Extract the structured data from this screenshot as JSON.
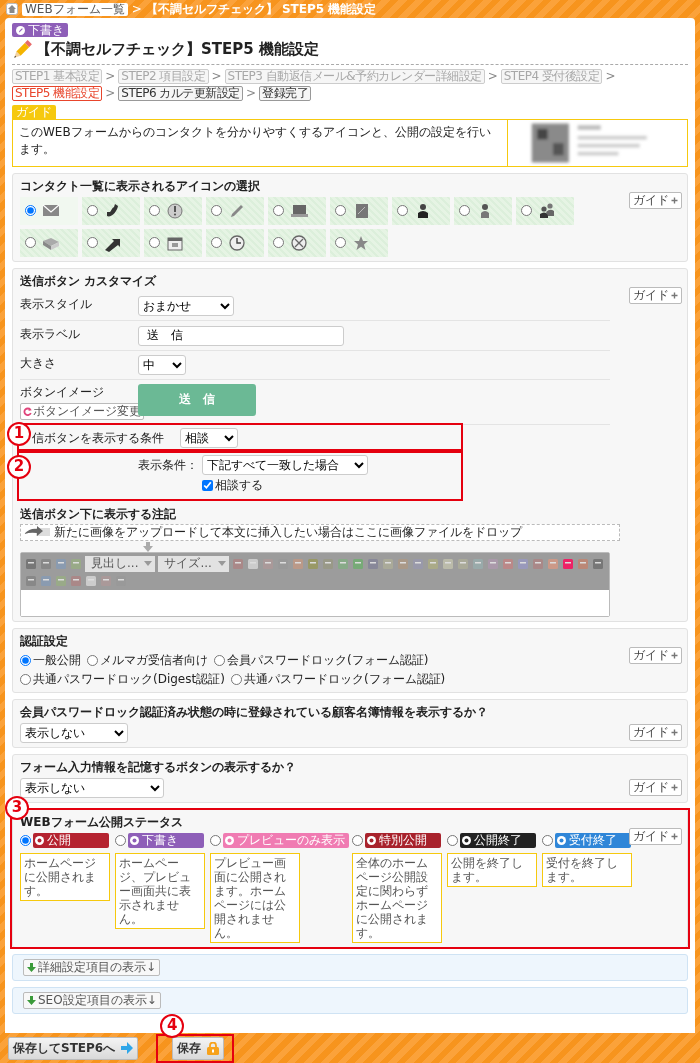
{
  "breadcrumb": {
    "links": [
      "WEBフォーム一覧"
    ],
    "separator": ">",
    "current": "【不調セルフチェック】 STEP5 機能設定"
  },
  "status_badge": "下書き",
  "page_title": "【不調セルフチェック】STEP5 機能設定",
  "step_separator": ">",
  "steps": [
    {
      "text": "STEP1 基本設定",
      "selected": false,
      "disabled": true
    },
    {
      "text": "STEP2 項目設定",
      "selected": false,
      "disabled": true
    },
    {
      "text": "STEP3 自動返信メール&予約カレンダー詳細設定",
      "selected": false,
      "disabled": true
    },
    {
      "text": "STEP4 受付後設定",
      "selected": false,
      "disabled": true
    },
    {
      "text": "STEP5 機能設定",
      "selected": true,
      "disabled": false
    },
    {
      "text": "STEP6 カルテ更新設定",
      "selected": false,
      "disabled": false
    },
    {
      "text": "登録完了",
      "selected": false,
      "disabled": false
    }
  ],
  "guide": {
    "tab": "ガイド",
    "text": "このWEBフォームからのコンタクトを分かりやすくするアイコンと、公開の設定を行います。"
  },
  "sections": [
    {
      "kind": "icon_select",
      "title": "コンタクト一覧に表示されるアイコンの選択",
      "guide_button": "ガイド",
      "icons": [
        {
          "selected": true
        },
        {
          "selected": false
        },
        {
          "selected": false
        },
        {
          "selected": false
        },
        {
          "selected": false
        },
        {
          "selected": false
        },
        {
          "selected": false
        },
        {
          "selected": false
        },
        {
          "selected": false
        },
        {
          "selected": false
        },
        {
          "selected": false
        },
        {
          "selected": false
        },
        {
          "selected": false
        },
        {
          "selected": false
        },
        {
          "selected": false
        }
      ]
    },
    {
      "kind": "button_custom",
      "title": "送信ボタン カスタマイズ",
      "guide_button": "ガイド",
      "rows": [
        {
          "kind": "select",
          "label": "表示スタイル",
          "value": "おまかせ"
        },
        {
          "kind": "input",
          "label": "表示ラベル",
          "value": "送　信"
        },
        {
          "kind": "select",
          "label": "大きさ",
          "value": "中"
        },
        {
          "label": "ボタンイメージ",
          "button": "ボタンイメージ変更",
          "preview": "送　信"
        },
        {
          "kind": "select",
          "label": "信ボタンを表示する条件",
          "value": "相談"
        },
        {
          "kind": "condition",
          "label": "表示条件：",
          "value": "下記すべて一致した場合",
          "checkbox": {
            "label": "相談する",
            "checked": true
          }
        }
      ],
      "note": {
        "label": "送信ボタン下に表示する注記",
        "drop_text": "新たに画像をアップロードして本文に挿入したい場合はここに画像ファイルをドロップ",
        "toolbar_selects": [
          "見出し...",
          "サイズ..."
        ]
      }
    },
    {
      "kind": "radios",
      "title": "認証設定",
      "guide_button": "ガイド",
      "options": [
        {
          "label": "一般公開",
          "selected": true
        },
        {
          "label": "メルマガ受信者向け",
          "selected": false
        },
        {
          "label": "会員パスワードロック(フォーム認証)",
          "selected": false
        },
        {
          "label": "共通パスワードロック(Digest認証)",
          "selected": false
        },
        {
          "label": "共通パスワードロック(フォーム認証)",
          "selected": false
        }
      ]
    },
    {
      "kind": "select",
      "title": "会員パスワードロック認証済み状態の時に登録されている顧客名簿情報を表示するか？",
      "guide_button": "ガイド",
      "value": "表示しない"
    },
    {
      "kind": "select",
      "title": "フォーム入力情報を記憶するボタンの表示するか？",
      "guide_button": "ガイド",
      "value": "表示しない"
    },
    {
      "kind": "status",
      "title": "WEBフォーム公開ステータス",
      "guide_button": "ガイド",
      "options": [
        {
          "label": "公開",
          "color": "#b52330",
          "selected": true,
          "description": "ホームページに公開されます。"
        },
        {
          "label": "下書き",
          "color": "#8e5fb8",
          "selected": false,
          "description": "ホームページ、プレビュー画面共に表示されません。"
        },
        {
          "label": "プレビューのみ表示",
          "color": "#f07bb2",
          "selected": false,
          "description": "プレビュー画面に公開されます。ホームページには公開されません。"
        },
        {
          "label": "特別公開",
          "color": "#a8222c",
          "selected": false,
          "description": "全体のホームページ公開設定に関わらずホームページに公開されます。"
        },
        {
          "label": "公開終了",
          "color": "#222222",
          "selected": false,
          "description": "公開を終了します。"
        },
        {
          "label": "受付終了",
          "color": "#2f86d8",
          "selected": false,
          "description": "受付を終了します。"
        }
      ]
    }
  ],
  "toggles": [
    "詳細設定項目の表示↓",
    "SEO設定項目の表示↓"
  ],
  "footer_buttons": [
    {
      "kind": "next",
      "text": "保存してSTEP6へ"
    },
    {
      "kind": "save",
      "text": "保存"
    }
  ],
  "annotations": [
    {
      "number": "1"
    },
    {
      "number": "2"
    },
    {
      "number": "3"
    },
    {
      "number": "4"
    }
  ]
}
